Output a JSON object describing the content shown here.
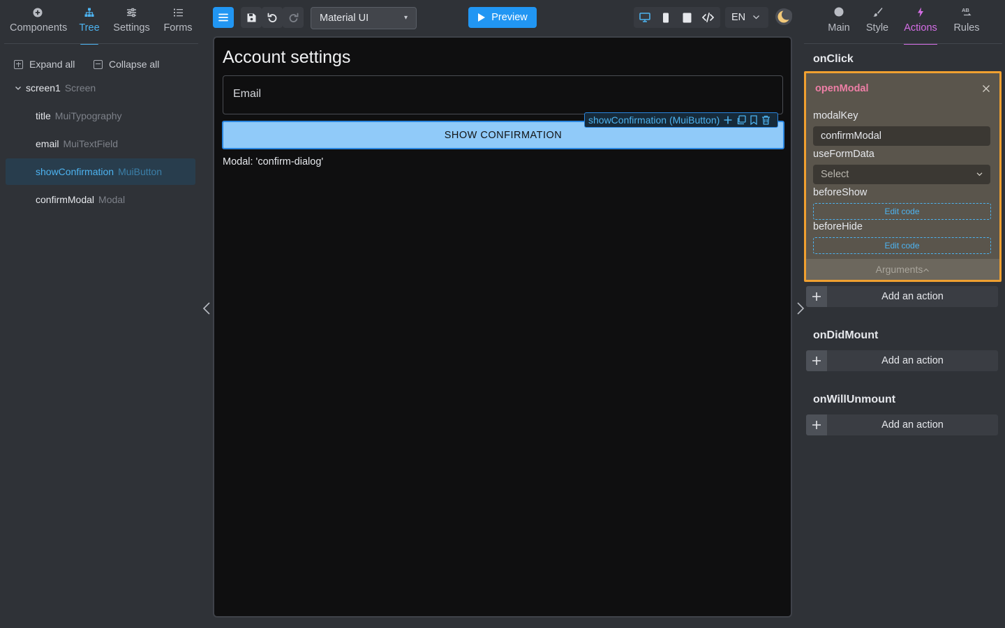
{
  "left_panel": {
    "tabs": [
      {
        "label": "Components",
        "icon": "plus-circle-icon"
      },
      {
        "label": "Tree",
        "icon": "sitemap-icon",
        "active": true
      },
      {
        "label": "Settings",
        "icon": "sliders-icon"
      },
      {
        "label": "Forms",
        "icon": "list-icon"
      }
    ],
    "expand_all": "Expand all",
    "collapse_all": "Collapse all",
    "tree": [
      {
        "name": "screen1",
        "type": "Screen"
      },
      {
        "name": "title",
        "type": "MuiTypography"
      },
      {
        "name": "email",
        "type": "MuiTextField"
      },
      {
        "name": "showConfirmation",
        "type": "MuiButton",
        "selected": true
      },
      {
        "name": "confirmModal",
        "type": "Modal"
      }
    ]
  },
  "toolbar": {
    "library": "Material UI",
    "preview_label": "Preview",
    "language": "EN"
  },
  "canvas": {
    "page_title": "Account settings",
    "email_label": "Email",
    "button_label": "SHOW CONFIRMATION",
    "selection_label": "showConfirmation (MuiButton)",
    "modal_text": "Modal: 'confirm-dialog'"
  },
  "right_panel": {
    "tabs": [
      {
        "label": "Main",
        "icon": "circle-icon"
      },
      {
        "label": "Style",
        "icon": "brush-icon"
      },
      {
        "label": "Actions",
        "icon": "bolt-icon",
        "active": true
      },
      {
        "label": "Rules",
        "icon": "ab-icon"
      }
    ],
    "onclick": {
      "event": "onClick",
      "action_name": "openModal",
      "modal_key_label": "modalKey",
      "modal_key_value": "confirmModal",
      "use_form_data_label": "useFormData",
      "use_form_data_placeholder": "Select",
      "before_show_label": "beforeShow",
      "before_hide_label": "beforeHide",
      "edit_code": "Edit code",
      "arguments": "Arguments",
      "add_action": "Add an action"
    },
    "ondidmount": {
      "event": "onDidMount",
      "add_action": "Add an action"
    },
    "onwillunmount": {
      "event": "onWillUnmount",
      "add_action": "Add an action"
    }
  },
  "colors": {
    "accent_blue": "#2196f3",
    "selection_blue": "#4db3f0",
    "actions_accent": "#d56ee6",
    "action_highlight": "#f0a030",
    "action_name": "#ee7fa6"
  }
}
